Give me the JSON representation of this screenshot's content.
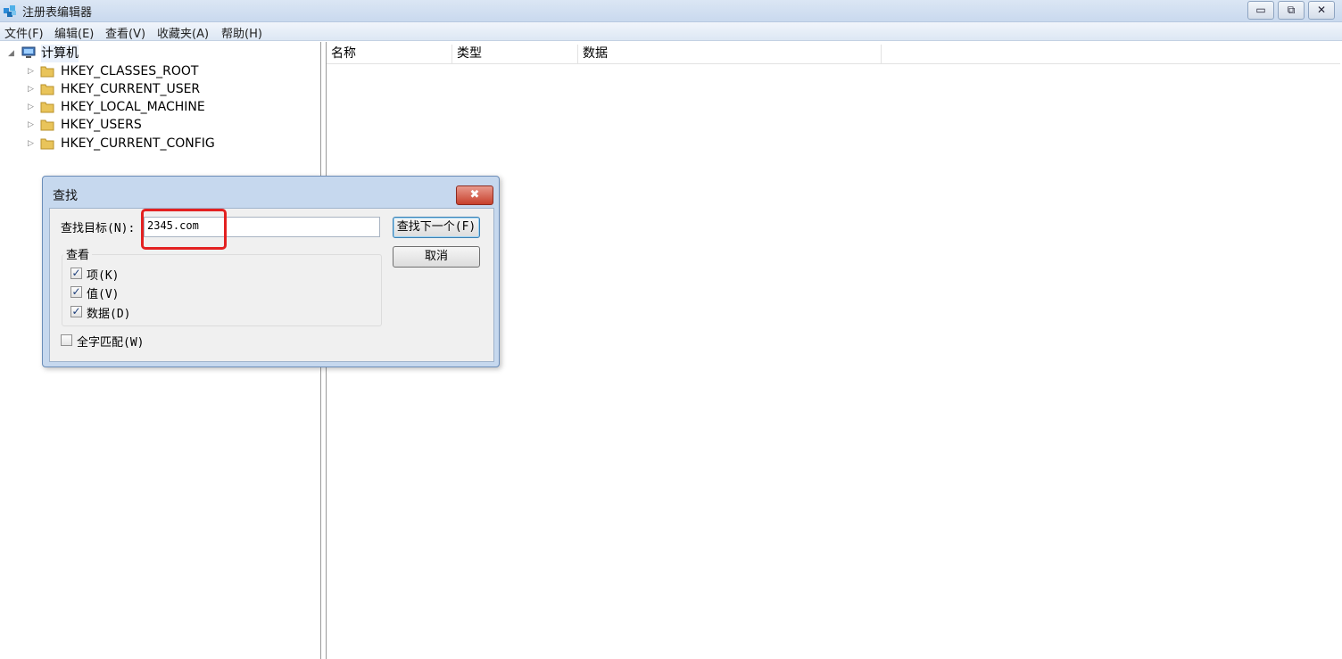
{
  "window": {
    "title": "注册表编辑器",
    "minimize_glyph": "▭",
    "restore_glyph": "⧉",
    "close_glyph": "✕"
  },
  "menu": {
    "items": [
      "文件(F)",
      "编辑(E)",
      "查看(V)",
      "收藏夹(A)",
      "帮助(H)"
    ]
  },
  "tree": {
    "root_label": "计算机",
    "root_expander": "◢",
    "child_expander": "▷",
    "children": [
      "HKEY_CLASSES_ROOT",
      "HKEY_CURRENT_USER",
      "HKEY_LOCAL_MACHINE",
      "HKEY_USERS",
      "HKEY_CURRENT_CONFIG"
    ]
  },
  "list": {
    "columns": [
      "名称",
      "类型",
      "数据"
    ]
  },
  "find_dialog": {
    "title": "查找",
    "close_glyph": "✖",
    "find_label": "查找目标(N):",
    "find_value": "2345.com",
    "find_next_label": "查找下一个(F)",
    "cancel_label": "取消",
    "look_at_label": "查看",
    "options": [
      {
        "label": "项(K)",
        "checked": true
      },
      {
        "label": "值(V)",
        "checked": true
      },
      {
        "label": "数据(D)",
        "checked": true
      }
    ],
    "whole_word": {
      "label": "全字匹配(W)",
      "checked": false
    },
    "check_glyph": "✓"
  },
  "colors": {
    "highlight_box": "#e32121",
    "title_bar": "#c9d9ee",
    "close_button": "#c7402c",
    "folder": "#e9c45a"
  }
}
